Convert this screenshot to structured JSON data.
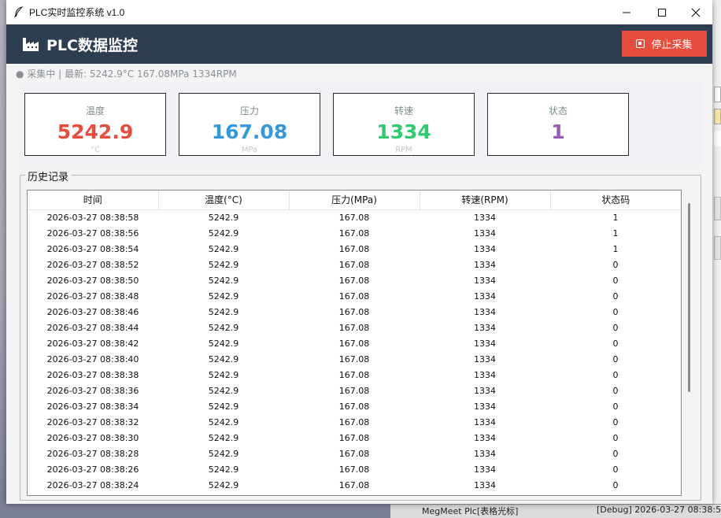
{
  "window": {
    "title": "PLC实时监控系统 v1.0"
  },
  "header": {
    "title": "PLC数据监控",
    "stop_button_label": "停止采集"
  },
  "status": {
    "text": "● 采集中  |  最新: 5242.9°C  167.08MPa  1334RPM"
  },
  "cards": [
    {
      "label": "温度",
      "value": "5242.9",
      "unit": "°C",
      "color": "#e74c3c"
    },
    {
      "label": "压力",
      "value": "167.08",
      "unit": "MPa",
      "color": "#3498db"
    },
    {
      "label": "转速",
      "value": "1334",
      "unit": "RPM",
      "color": "#2ecc71"
    },
    {
      "label": "状态",
      "value": "1",
      "unit": "",
      "color": "#9b59b6"
    }
  ],
  "history": {
    "legend": "历史记录",
    "columns": [
      "时间",
      "温度(°C)",
      "压力(MPa)",
      "转速(RPM)",
      "状态码"
    ],
    "rows": [
      [
        "2026-03-27 08:38:58",
        "5242.9",
        "167.08",
        "1334",
        "1"
      ],
      [
        "2026-03-27 08:38:56",
        "5242.9",
        "167.08",
        "1334",
        "1"
      ],
      [
        "2026-03-27 08:38:54",
        "5242.9",
        "167.08",
        "1334",
        "1"
      ],
      [
        "2026-03-27 08:38:52",
        "5242.9",
        "167.08",
        "1334",
        "0"
      ],
      [
        "2026-03-27 08:38:50",
        "5242.9",
        "167.08",
        "1334",
        "0"
      ],
      [
        "2026-03-27 08:38:48",
        "5242.9",
        "167.08",
        "1334",
        "0"
      ],
      [
        "2026-03-27 08:38:46",
        "5242.9",
        "167.08",
        "1334",
        "0"
      ],
      [
        "2026-03-27 08:38:44",
        "5242.9",
        "167.08",
        "1334",
        "0"
      ],
      [
        "2026-03-27 08:38:42",
        "5242.9",
        "167.08",
        "1334",
        "0"
      ],
      [
        "2026-03-27 08:38:40",
        "5242.9",
        "167.08",
        "1334",
        "0"
      ],
      [
        "2026-03-27 08:38:38",
        "5242.9",
        "167.08",
        "1334",
        "0"
      ],
      [
        "2026-03-27 08:38:36",
        "5242.9",
        "167.08",
        "1334",
        "0"
      ],
      [
        "2026-03-27 08:38:34",
        "5242.9",
        "167.08",
        "1334",
        "0"
      ],
      [
        "2026-03-27 08:38:32",
        "5242.9",
        "167.08",
        "1334",
        "0"
      ],
      [
        "2026-03-27 08:38:30",
        "5242.9",
        "167.08",
        "1334",
        "0"
      ],
      [
        "2026-03-27 08:38:28",
        "5242.9",
        "167.08",
        "1334",
        "0"
      ],
      [
        "2026-03-27 08:38:26",
        "5242.9",
        "167.08",
        "1334",
        "0"
      ],
      [
        "2026-03-27 08:38:24",
        "5242.9",
        "167.08",
        "1334",
        "0"
      ]
    ]
  },
  "background": {
    "taskbar_text": "MegMeet Plc[表格光标]",
    "log_text": "[Debug] 2026-03-27 08:38:5"
  },
  "icons": {
    "app": "feather-icon",
    "header": "factory-icon",
    "stop": "stop-icon"
  },
  "colors": {
    "header_bg": "#2c3e50",
    "stop_button": "#e74c3c"
  }
}
